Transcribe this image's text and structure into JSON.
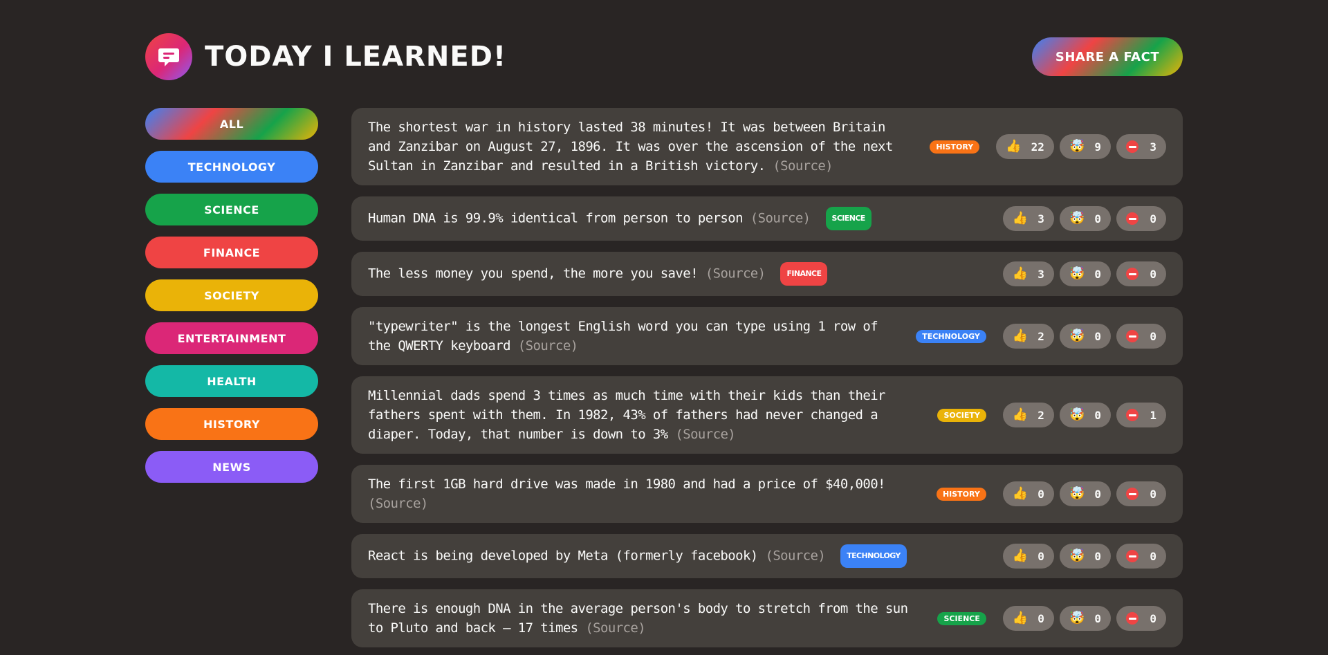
{
  "header": {
    "title": "Today I Learned!",
    "share_label": "Share a fact"
  },
  "colors": {
    "background": "#292524",
    "card": "#44403c",
    "vote_bg": "#78716c",
    "source": "#a8a29e"
  },
  "categories": [
    {
      "label": "All",
      "color": "gradient"
    },
    {
      "label": "Technology",
      "color": "#3b82f6"
    },
    {
      "label": "Science",
      "color": "#16a34a"
    },
    {
      "label": "Finance",
      "color": "#ef4444"
    },
    {
      "label": "Society",
      "color": "#eab308"
    },
    {
      "label": "Entertainment",
      "color": "#db2777"
    },
    {
      "label": "Health",
      "color": "#14b8a6"
    },
    {
      "label": "History",
      "color": "#f97316"
    },
    {
      "label": "News",
      "color": "#8b5cf6"
    }
  ],
  "source_label": "(Source)",
  "vote_icons": [
    "thumbs-up-icon",
    "mind-blown-icon",
    "no-entry-icon"
  ],
  "facts": [
    {
      "text": "The shortest war in history lasted 38 minutes! It was between Britain and Zanzibar on August 27, 1896. It was over the ascension of the next Sultan in Zanzibar and resulted in a British victory.",
      "category": "history",
      "tag_color": "#f97316",
      "tag_inline": false,
      "interesting": "22",
      "mindblowing": "9",
      "false": "3"
    },
    {
      "text": "Human DNA is 99.9% identical from person to person",
      "category": "science",
      "tag_color": "#16a34a",
      "tag_inline": true,
      "interesting": "3",
      "mindblowing": "0",
      "false": "0"
    },
    {
      "text": "The less money you spend, the more you save!",
      "category": "finance",
      "tag_color": "#ef4444",
      "tag_inline": true,
      "interesting": "3",
      "mindblowing": "0",
      "false": "0"
    },
    {
      "text": "\"typewriter\" is the longest English word you can type using 1 row of the QWERTY keyboard",
      "category": "technology",
      "tag_color": "#3b82f6",
      "tag_inline": false,
      "interesting": "2",
      "mindblowing": "0",
      "false": "0"
    },
    {
      "text": "Millennial dads spend 3 times as much time with their kids than their fathers spent with them. In 1982, 43% of fathers had never changed a diaper. Today, that number is down to 3%",
      "category": "society",
      "tag_color": "#eab308",
      "tag_inline": false,
      "interesting": "2",
      "mindblowing": "0",
      "false": "1"
    },
    {
      "text": "The first 1GB hard drive was made in 1980 and had a price of $40,000!",
      "category": "history",
      "tag_color": "#f97316",
      "tag_inline": false,
      "interesting": "0",
      "mindblowing": "0",
      "false": "0"
    },
    {
      "text": "React is being developed by Meta (formerly facebook)",
      "category": "technology",
      "tag_color": "#3b82f6",
      "tag_inline": true,
      "interesting": "0",
      "mindblowing": "0",
      "false": "0"
    },
    {
      "text": "There is enough DNA in the average person's body to stretch from the sun to Pluto and back — 17 times",
      "category": "science",
      "tag_color": "#16a34a",
      "tag_inline": false,
      "interesting": "0",
      "mindblowing": "0",
      "false": "0"
    }
  ]
}
